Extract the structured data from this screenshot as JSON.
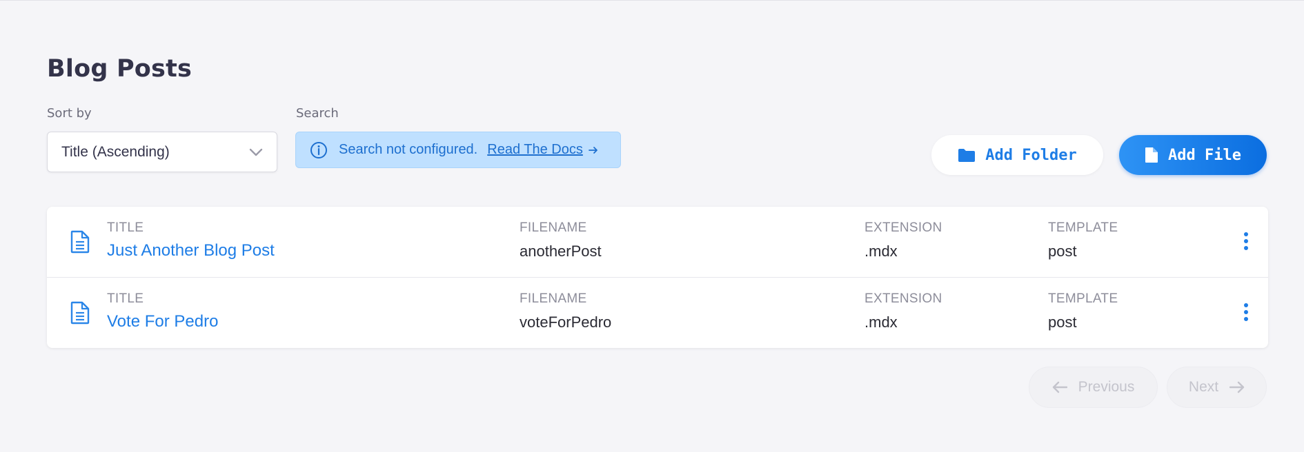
{
  "page": {
    "title": "Blog Posts"
  },
  "sort": {
    "label": "Sort by",
    "selected": "Title (Ascending)"
  },
  "search": {
    "label": "Search",
    "message": "Search not configured.",
    "docs_link": "Read The Docs"
  },
  "actions": {
    "add_folder": "Add Folder",
    "add_file": "Add File"
  },
  "rows": [
    {
      "title_label": "TITLE",
      "title": "Just Another Blog Post",
      "filename_label": "FILENAME",
      "filename": "anotherPost",
      "extension_label": "EXTENSION",
      "extension": ".mdx",
      "template_label": "TEMPLATE",
      "template": "post"
    },
    {
      "title_label": "TITLE",
      "title": "Vote For Pedro",
      "filename_label": "FILENAME",
      "filename": "voteForPedro",
      "extension_label": "EXTENSION",
      "extension": ".mdx",
      "template_label": "TEMPLATE",
      "template": "post"
    }
  ],
  "pagination": {
    "previous": "Previous",
    "next": "Next"
  },
  "icons": {
    "sort": "chevron-down-icon",
    "info": "info-icon",
    "docs": "arrow-right-icon",
    "folder": "folder-icon",
    "file": "file-icon",
    "row": "document-icon",
    "menu": "kebab-menu-icon",
    "prev": "arrow-left-icon",
    "next": "arrow-right-icon"
  },
  "colors": {
    "accent": "#1e7de6",
    "background": "#f5f5f8",
    "info_bg": "#bfe0ff"
  }
}
